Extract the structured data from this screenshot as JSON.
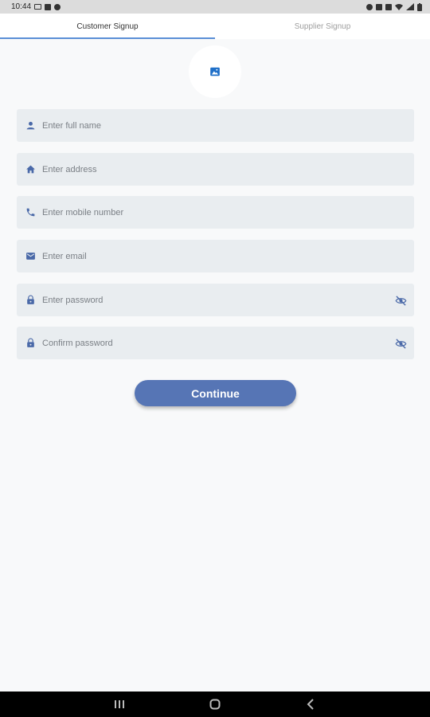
{
  "status_bar": {
    "time": "10:44"
  },
  "tabs": [
    {
      "label": "Customer Signup",
      "active": true
    },
    {
      "label": "Supplier Signup",
      "active": false
    }
  ],
  "avatar": {
    "icon": "image-icon"
  },
  "fields": {
    "full_name": {
      "placeholder": "Enter full name",
      "icon": "person-icon"
    },
    "address": {
      "placeholder": "Enter address",
      "icon": "home-icon"
    },
    "mobile": {
      "placeholder": "Enter mobile number",
      "icon": "phone-icon"
    },
    "email": {
      "placeholder": "Enter email",
      "icon": "mail-icon"
    },
    "password": {
      "placeholder": "Enter password",
      "icon": "lock-icon"
    },
    "confirm_password": {
      "placeholder": "Confirm password",
      "icon": "lock-icon"
    }
  },
  "continue_label": "Continue",
  "colors": {
    "accent": "#5675b5",
    "icon": "#4a69a8",
    "field_bg": "#e9edf0",
    "tab_indicator": "#5b8fd6"
  }
}
